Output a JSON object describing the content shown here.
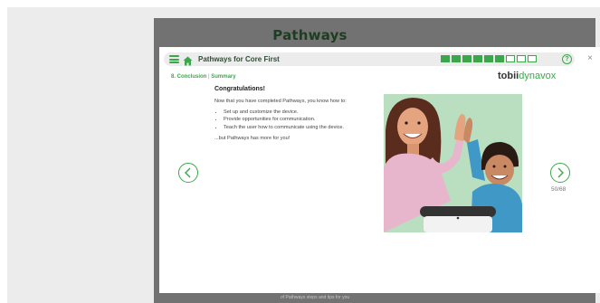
{
  "app": {
    "brand": "Pathways"
  },
  "topbar": {
    "menu_icon": "hamburger-menu-icon",
    "home_icon": "home-icon",
    "title": "Pathways for Core First",
    "progress": {
      "total_segments": 9,
      "completed_segments": 6
    },
    "help_glyph": "?",
    "close_glyph": "×"
  },
  "breadcrumb": {
    "section": "8. Conclusion",
    "separator": "|",
    "page": "Summary"
  },
  "logo": {
    "part1": "tobii",
    "part2": "dynavox"
  },
  "content": {
    "heading": "Congratulations!",
    "intro": "Now that you have completed Pathways, you know how to:",
    "bullets": [
      "Set up and customize the device.",
      "Provide opportunities for communication.",
      "Teach the user how to communicate using the device."
    ],
    "outro": "...but Pathways has more for you!"
  },
  "navigation": {
    "prev_icon": "chevron-left-icon",
    "next_icon": "chevron-right-icon",
    "page_counter": "50/68"
  },
  "footer": {
    "faded_text": "of Pathways steps and tips for you"
  },
  "colors": {
    "accent": "#3aa84a",
    "brand_text": "#1e3d22",
    "backdrop": "#727272",
    "illustration_bg": "#b9dfc0"
  }
}
